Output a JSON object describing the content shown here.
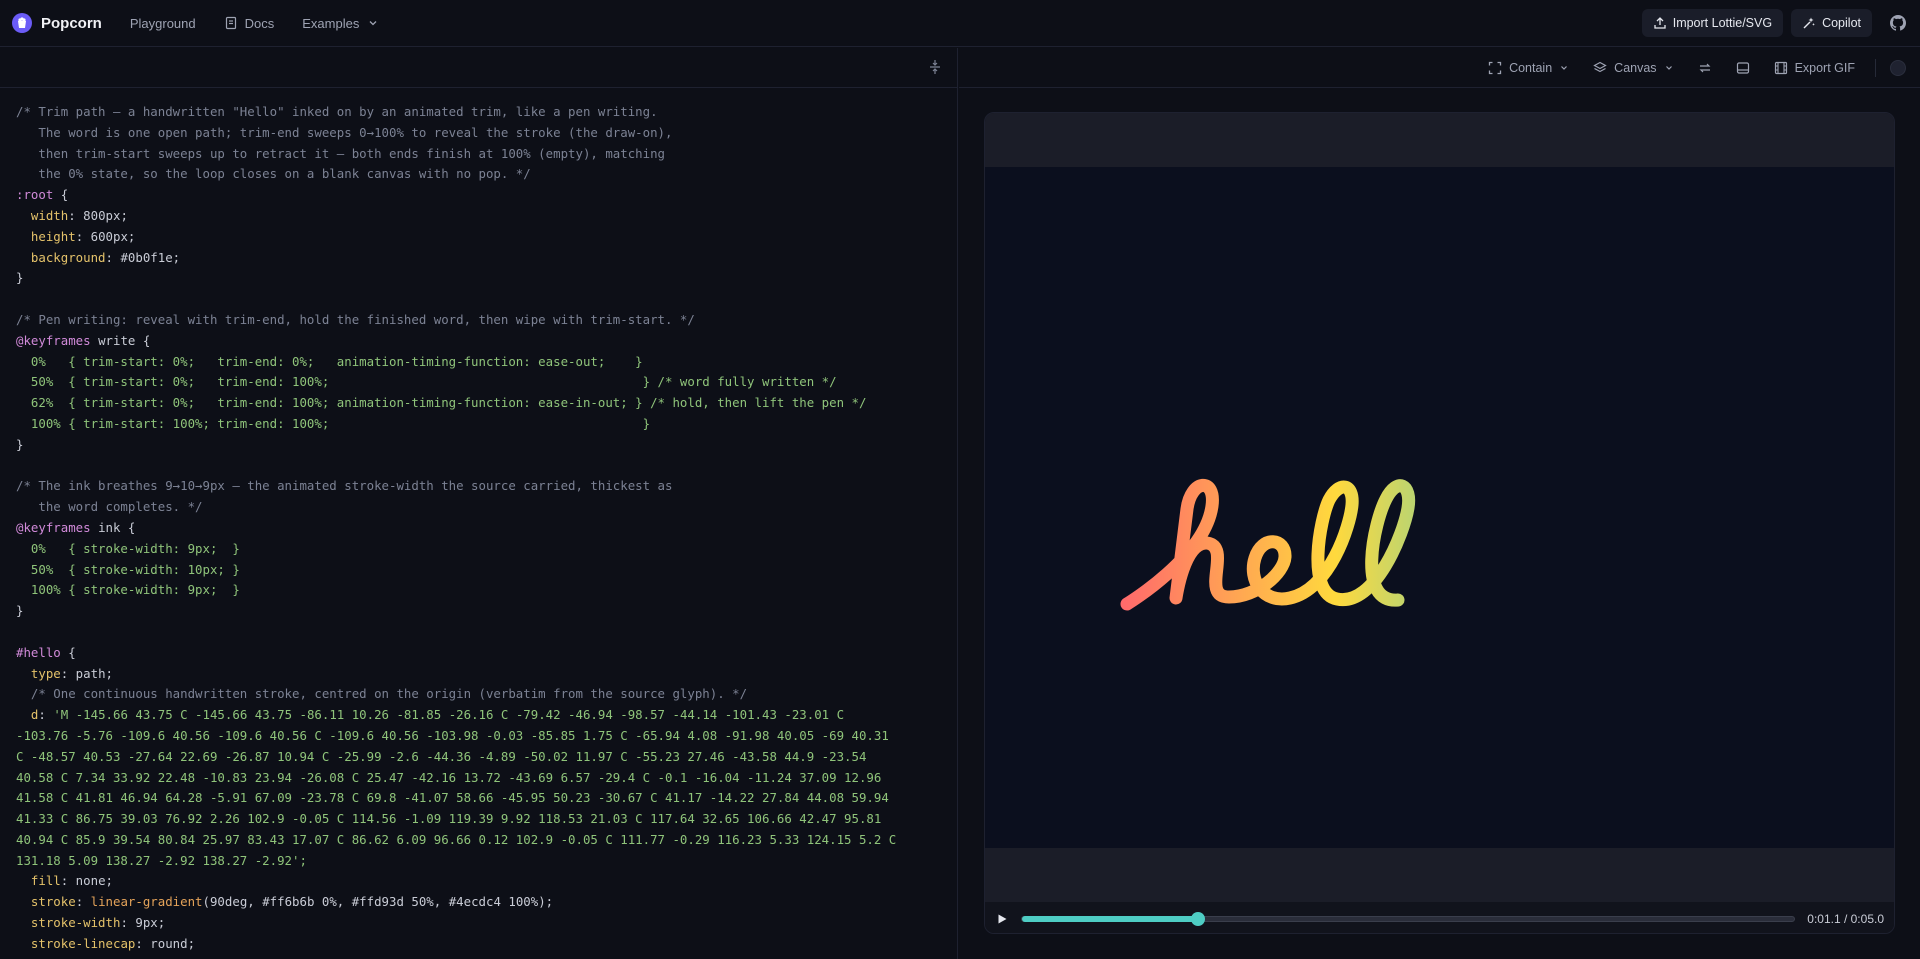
{
  "app": {
    "name": "Popcorn",
    "nav": [
      "Playground",
      "Docs",
      "Examples"
    ],
    "import_label": "Import Lottie/SVG",
    "copilot_label": "Copilot"
  },
  "preview": {
    "fit_label": "Contain",
    "layer_label": "Canvas",
    "export_label": "Export GIF",
    "time": "0:01.1 / 0:05.0",
    "progress": 0.228
  },
  "code_lines": [
    "/* Trim path — a handwritten \"Hello\" inked on by an animated trim, like a pen writing.",
    "   The word is one open path; trim-end sweeps 0→100% to reveal the stroke (the draw-on),",
    "   then trim-start sweeps up to retract it — both ends finish at 100% (empty), matching",
    "   the 0% state, so the loop closes on a blank canvas with no pop. */",
    ":root {",
    "  width: 800px;",
    "  height: 600px;",
    "  background: #0b0f1e;",
    "}",
    "",
    "/* Pen writing: reveal with trim-end, hold the finished word, then wipe with trim-start. */",
    "@keyframes write {",
    "  0%   { trim-start: 0%;   trim-end: 0%;   animation-timing-function: ease-out;    }",
    "  50%  { trim-start: 0%;   trim-end: 100%;                                          } /* word fully written */",
    "  62%  { trim-start: 0%;   trim-end: 100%; animation-timing-function: ease-in-out; } /* hold, then lift the pen */",
    "  100% { trim-start: 100%; trim-end: 100%;                                          }",
    "}",
    "",
    "/* The ink breathes 9→10→9px — the animated stroke-width the source carried, thickest as",
    "   the word completes. */",
    "@keyframes ink {",
    "  0%   { stroke-width: 9px;  }",
    "  50%  { stroke-width: 10px; }",
    "  100% { stroke-width: 9px;  }",
    "}",
    "",
    "#hello {",
    "  type: path;",
    "  /* One continuous handwritten stroke, centred on the origin (verbatim from the source glyph). */",
    "  d: 'M -145.66 43.75 C -145.66 43.75 -86.11 10.26 -81.85 -26.16 C -79.42 -46.94 -98.57 -44.14 -101.43 -23.01 C",
    "-103.76 -5.76 -109.6 40.56 -109.6 40.56 C -109.6 40.56 -103.98 -0.03 -85.85 1.75 C -65.94 4.08 -91.98 40.05 -69 40.31",
    "C -48.57 40.53 -27.64 22.69 -26.87 10.94 C -25.99 -2.6 -44.36 -4.89 -50.02 11.97 C -55.23 27.46 -43.58 44.9 -23.54",
    "40.58 C 7.34 33.92 22.48 -10.83 23.94 -26.08 C 25.47 -42.16 13.72 -43.69 6.57 -29.4 C -0.1 -16.04 -11.24 37.09 12.96",
    "41.58 C 41.81 46.94 64.28 -5.91 67.09 -23.78 C 69.8 -41.07 58.66 -45.95 50.23 -30.67 C 41.17 -14.22 27.84 44.08 59.94",
    "41.33 C 86.75 39.03 76.92 2.26 102.9 -0.05 C 114.56 -1.09 119.39 9.92 118.53 21.03 C 117.64 32.65 106.66 42.47 95.81",
    "40.94 C 85.9 39.54 80.84 25.97 83.43 17.07 C 86.62 6.09 96.66 0.12 102.9 -0.05 C 111.77 -0.29 116.23 5.33 124.15 5.2 C",
    "131.18 5.09 138.27 -2.92 138.27 -2.92';",
    "  fill: none;",
    "  stroke: linear-gradient(90deg, #ff6b6b 0%, #ffd93d 50%, #4ecdc4 100%);",
    "  stroke-width: 9px;",
    "  stroke-linecap: round;"
  ]
}
